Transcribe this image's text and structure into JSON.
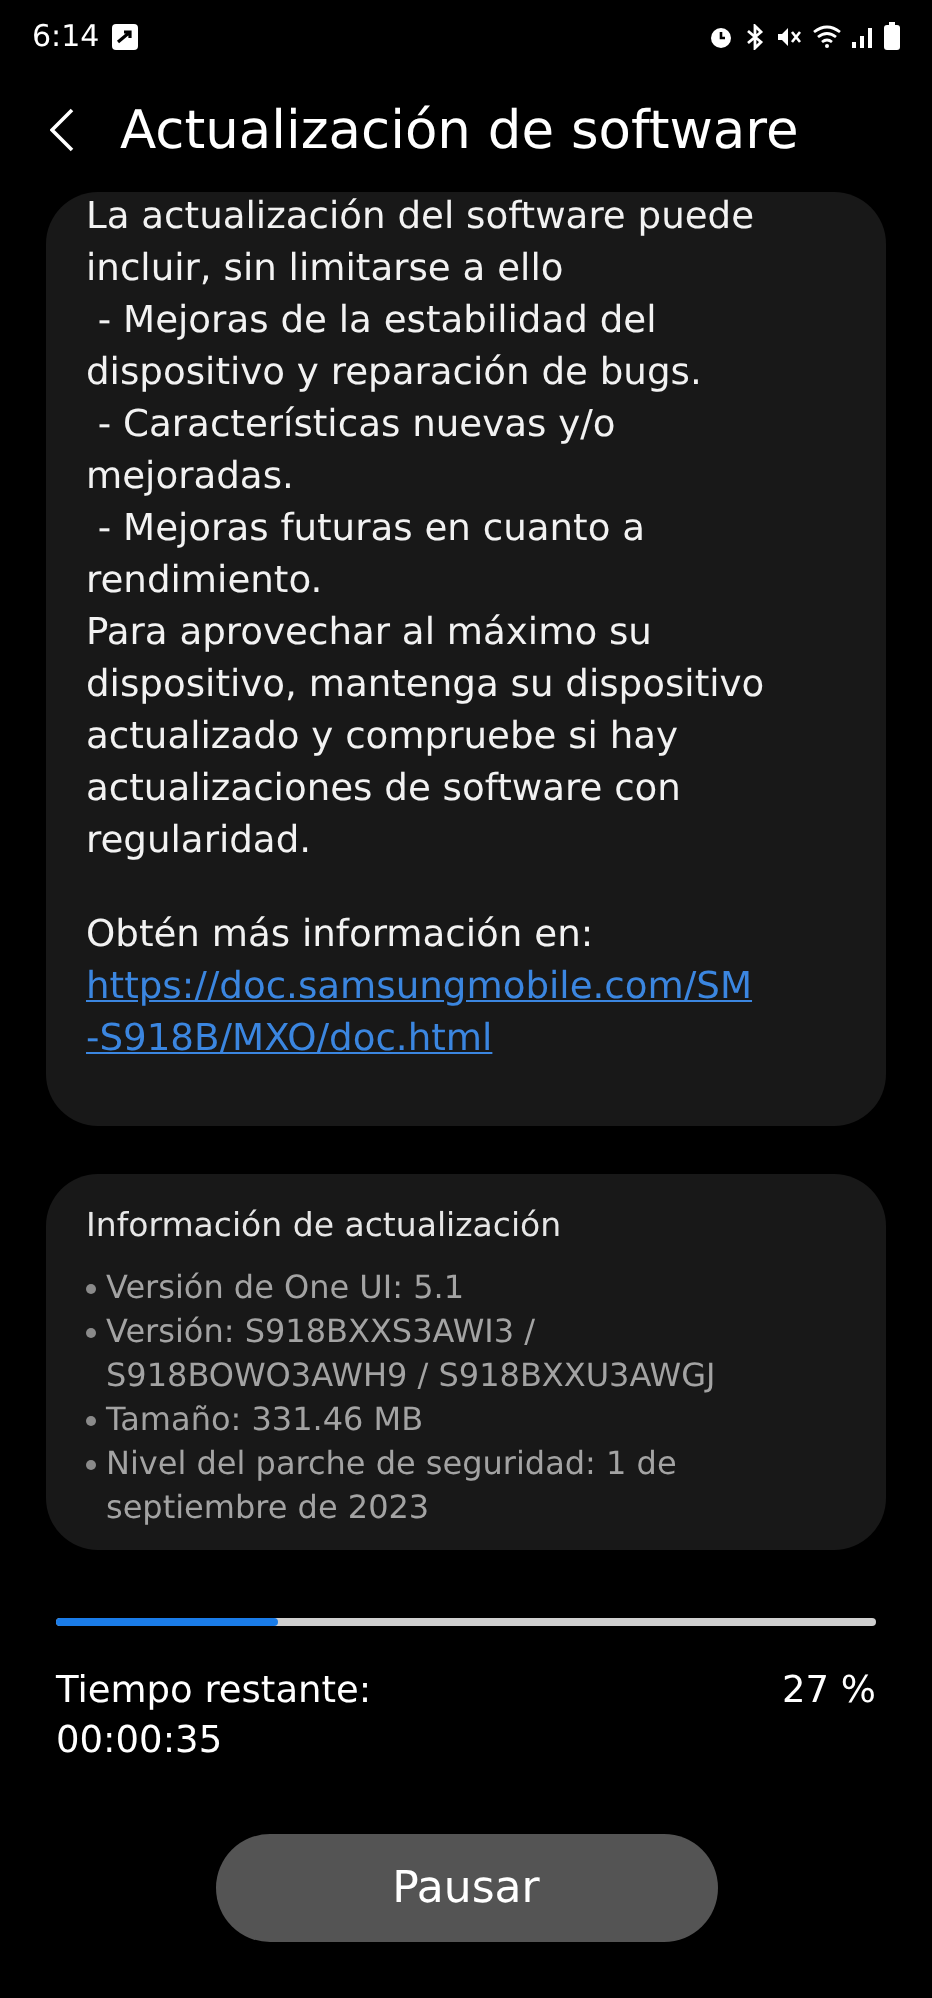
{
  "status_bar": {
    "time": "6:14"
  },
  "header": {
    "title": "Actualización de software"
  },
  "description": {
    "lines": [
      "La actualización del software puede",
      "incluir, sin limitarse a ello",
      " - Mejoras de la estabilidad del",
      "dispositivo y reparación de bugs.",
      " - Características nuevas y/o",
      "mejoradas.",
      " - Mejoras futuras en cuanto a",
      "rendimiento.",
      "Para aprovechar al máximo su",
      "dispositivo, mantenga su dispositivo",
      "actualizado y compruebe si hay",
      "actualizaciones de software con",
      "regularidad."
    ],
    "more_info": "Obtén más información en:",
    "link_lines": [
      "https://doc.samsungmobile.com/SM",
      "-S918B/MXO/doc.html"
    ]
  },
  "update_info": {
    "title": "Información de actualización",
    "items": [
      {
        "lines": [
          "Versión de One UI: 5.1"
        ]
      },
      {
        "lines": [
          "Versión: S918BXXS3AWI3 /",
          "S918BOWO3AWH9 / S918BXXU3AWGJ"
        ]
      },
      {
        "lines": [
          "Tamaño: 331.46 MB"
        ]
      },
      {
        "lines": [
          "Nivel del parche de seguridad: 1 de",
          "septiembre de 2023"
        ]
      }
    ]
  },
  "progress": {
    "level": 0.27,
    "time_label": "Tiempo restante:",
    "time_value": "00:00:35",
    "percent": "27 %"
  },
  "button": {
    "label": "Pausar"
  }
}
